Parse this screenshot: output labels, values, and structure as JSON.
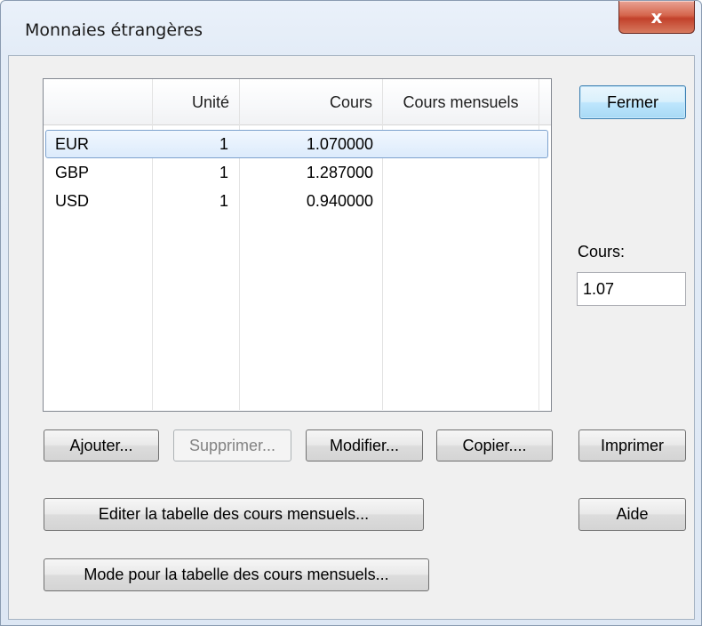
{
  "window": {
    "title": "Monnaies étrangères",
    "close_label": "x"
  },
  "table": {
    "headers": [
      "",
      "Unité",
      "Cours",
      "Cours mensuels"
    ],
    "rows": [
      {
        "currency": "EUR",
        "unit": "1",
        "rate": "1.070000",
        "monthly": "",
        "selected": true
      },
      {
        "currency": "GBP",
        "unit": "1",
        "rate": "1.287000",
        "monthly": "",
        "selected": false
      },
      {
        "currency": "USD",
        "unit": "1",
        "rate": "0.940000",
        "monthly": "",
        "selected": false
      }
    ]
  },
  "buttons": {
    "close": "Fermer",
    "add": "Ajouter...",
    "delete": "Supprimer...",
    "modify": "Modifier...",
    "copy": "Copier....",
    "print": "Imprimer",
    "edit_monthly": "Editer la tabelle des cours mensuels...",
    "help": "Aide",
    "mode_monthly": "Mode pour la tabelle des cours mensuels..."
  },
  "rate_field": {
    "label": "Cours:",
    "value": "1.07"
  }
}
